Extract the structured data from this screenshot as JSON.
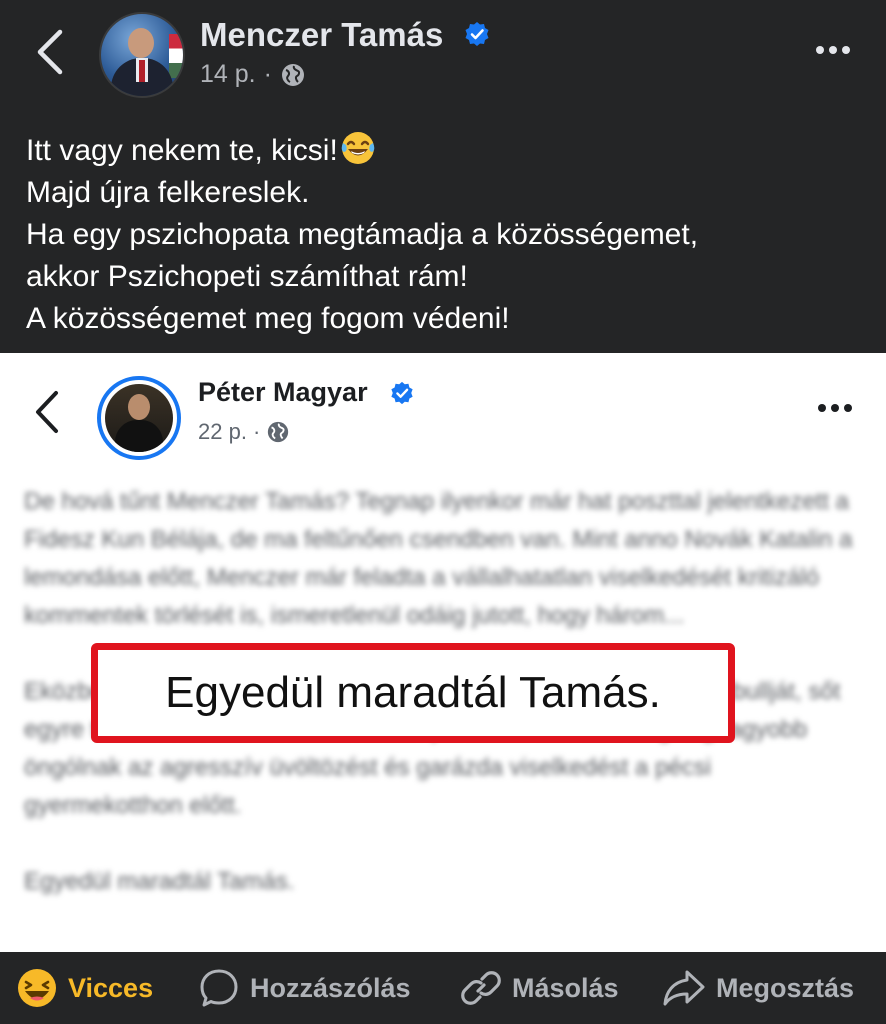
{
  "header": {
    "author": "Menczer Tamás",
    "time": "14 p.",
    "separator": "·"
  },
  "post": {
    "lines": [
      "Itt vagy nekem te, kicsi!",
      "Majd újra felkereslek.",
      "Ha egy pszichopata megtámadja a közösségemet,",
      "akkor Pszichopeti számíthat rám!",
      "A közösségemet meg fogom védeni!"
    ]
  },
  "screenshot": {
    "author": "Péter Magyar",
    "time": "22 p.",
    "separator": "·",
    "paragraphs": [
      "De hová tűnt Menczer Tamás? Tegnap ilyenkor már hat poszttal jelentkezett a Fidesz Kun Bélája, de ma feltűnően csendben van. Mint anno Novák Katalin a lemondása előtt, Menczer már feladta a vállalhatatlan viselkedését kritizáló kommentek törlését is, ismeretlenül odáig jutott, hogy három...",
      "Eközben reggel óta már a fideszes politikusok sem védik Orbán pitbullját, sőt egyre többen nevezik a holdudvarban pánikszerűen az eddigi legnagyobb öngólnak az agresszív üvöltözést és garázda viselkedést a pécsi gyermekotthon előtt.",
      "Egyedül maradtál Tamás."
    ],
    "highlight": "Egyedül maradtál Tamás."
  },
  "actions": {
    "react": "Vicces",
    "comment": "Hozzászólás",
    "copy": "Másolás",
    "share": "Megosztás"
  },
  "colors": {
    "background": "#242526",
    "verified": "#1877f2",
    "highlight_border": "#e0141e",
    "react_active": "#f7b928"
  }
}
